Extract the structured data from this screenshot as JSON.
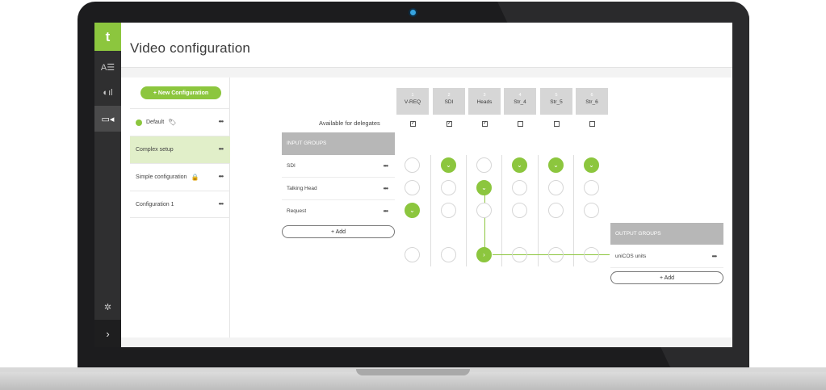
{
  "app": {
    "logo_glyph": "t",
    "page_title": "Video configuration",
    "accent_color": "#8cc63e"
  },
  "rail": {
    "items": [
      {
        "name": "presenter-screen-icon",
        "glyph": "A☰"
      },
      {
        "name": "stats-icon",
        "glyph": "◐ıl"
      },
      {
        "name": "video-camera-icon",
        "glyph": "▭◂"
      }
    ],
    "settings_glyph": "✲",
    "expand_glyph": "›"
  },
  "configs": {
    "new_button_label": "+  New Configuration",
    "items": [
      {
        "label": "Default",
        "more": "•••",
        "badge": "active-dot",
        "icon": "tag-icon"
      },
      {
        "label": "Complex setup",
        "more": "•••"
      },
      {
        "label": "Simple configuration",
        "more": "•••",
        "icon": "lock-icon"
      },
      {
        "label": "Configuration 1",
        "more": "•••"
      }
    ]
  },
  "matrix": {
    "available_label": "Available for delegates",
    "columns": [
      {
        "num": "1",
        "name": "V-REQ",
        "available": true
      },
      {
        "num": "2",
        "name": "SDI",
        "available": true
      },
      {
        "num": "3",
        "name": "Heads",
        "available": true
      },
      {
        "num": "4",
        "name": "Str_4",
        "available": false
      },
      {
        "num": "5",
        "name": "Str_5",
        "available": false
      },
      {
        "num": "6",
        "name": "Str_6",
        "available": false
      }
    ],
    "input_groups_header": "INPUT GROUPS",
    "input_groups": [
      {
        "label": "SDI",
        "more": "•••",
        "active_columns": [
          2,
          4,
          5,
          6
        ]
      },
      {
        "label": "Talking Head",
        "more": "•••",
        "active_columns": [
          3
        ]
      },
      {
        "label": "Request",
        "more": "•••",
        "active_columns": [
          1
        ]
      }
    ],
    "add_input_label": "+  Add",
    "output_groups_header": "OUTPUT GROUPS",
    "output_groups": [
      {
        "label": "uniCOS units",
        "more": "•••",
        "active_columns": [
          3
        ]
      }
    ],
    "add_output_label": "+  Add"
  }
}
